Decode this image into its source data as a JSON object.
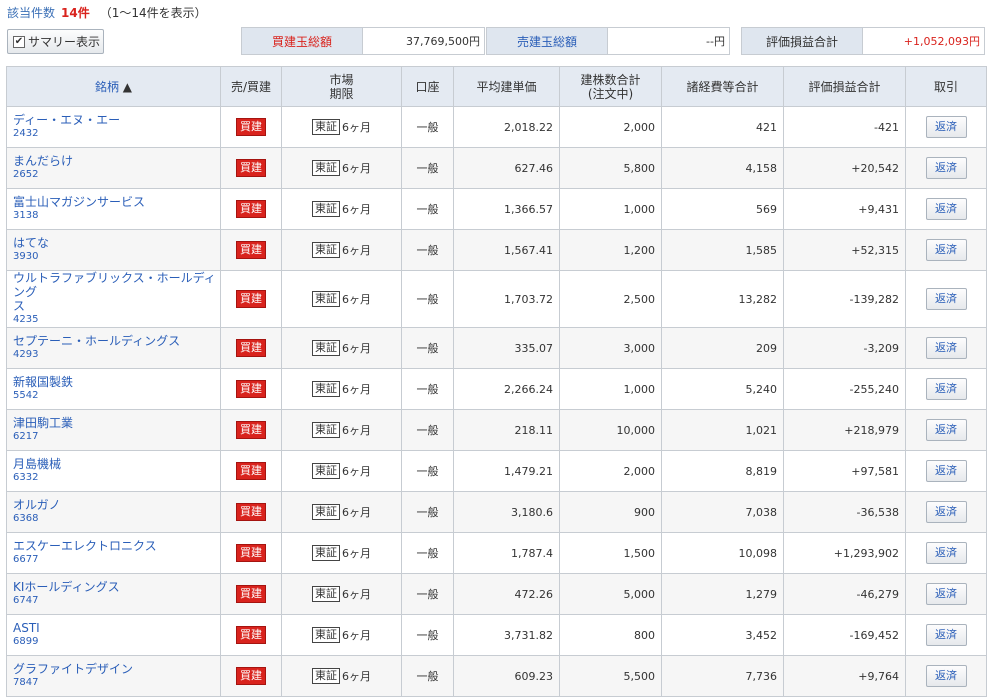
{
  "header": {
    "count_label": "該当件数",
    "count_value": "14件",
    "count_range": "（1〜14件を表示）",
    "summary_toggle": "サマリー表示",
    "summary_checkbox": "✔"
  },
  "summary": {
    "buy_label": "買建玉総額",
    "buy_value": "37,769,500円",
    "sell_label": "売建玉総額",
    "sell_value": "--円",
    "pl_label": "評価損益合計",
    "pl_value": "+1,052,093円"
  },
  "table": {
    "headers": {
      "name": "銘柄",
      "name_sort": "▲",
      "side": "売/買建",
      "market1": "市場",
      "market2": "期限",
      "account": "口座",
      "avg_price": "平均建単価",
      "qty1": "建株数合計",
      "qty2": "(注文中)",
      "fees": "諸経費等合計",
      "pl": "評価損益合計",
      "trade": "取引"
    },
    "rows": [
      {
        "name": "ディー・エヌ・エー",
        "code": "2432",
        "side": "買建",
        "market": "東証",
        "term": "6ヶ月",
        "account": "一般",
        "avg": "2,018.22",
        "qty": "2,000",
        "fees": "421",
        "pl": "-421",
        "pl_sign": "neg",
        "action": "返済"
      },
      {
        "name": "まんだらけ",
        "code": "2652",
        "side": "買建",
        "market": "東証",
        "term": "6ヶ月",
        "account": "一般",
        "avg": "627.46",
        "qty": "5,800",
        "fees": "4,158",
        "pl": "+20,542",
        "pl_sign": "pos",
        "action": "返済"
      },
      {
        "name": "富士山マガジンサービス",
        "code": "3138",
        "side": "買建",
        "market": "東証",
        "term": "6ヶ月",
        "account": "一般",
        "avg": "1,366.57",
        "qty": "1,000",
        "fees": "569",
        "pl": "+9,431",
        "pl_sign": "pos",
        "action": "返済"
      },
      {
        "name": "はてな",
        "code": "3930",
        "side": "買建",
        "market": "東証",
        "term": "6ヶ月",
        "account": "一般",
        "avg": "1,567.41",
        "qty": "1,200",
        "fees": "1,585",
        "pl": "+52,315",
        "pl_sign": "pos",
        "action": "返済"
      },
      {
        "name": "ウルトラファブリックス・ホールディング",
        "name2": "ス",
        "code": "4235",
        "side": "買建",
        "market": "東証",
        "term": "6ヶ月",
        "account": "一般",
        "avg": "1,703.72",
        "qty": "2,500",
        "fees": "13,282",
        "pl": "-139,282",
        "pl_sign": "neg",
        "action": "返済"
      },
      {
        "name": "セプテーニ・ホールディングス",
        "code": "4293",
        "side": "買建",
        "market": "東証",
        "term": "6ヶ月",
        "account": "一般",
        "avg": "335.07",
        "qty": "3,000",
        "fees": "209",
        "pl": "-3,209",
        "pl_sign": "neg",
        "action": "返済"
      },
      {
        "name": "新報国製鉄",
        "code": "5542",
        "side": "買建",
        "market": "東証",
        "term": "6ヶ月",
        "account": "一般",
        "avg": "2,266.24",
        "qty": "1,000",
        "fees": "5,240",
        "pl": "-255,240",
        "pl_sign": "neg",
        "action": "返済"
      },
      {
        "name": "津田駒工業",
        "code": "6217",
        "side": "買建",
        "market": "東証",
        "term": "6ヶ月",
        "account": "一般",
        "avg": "218.11",
        "qty": "10,000",
        "fees": "1,021",
        "pl": "+218,979",
        "pl_sign": "pos",
        "action": "返済"
      },
      {
        "name": "月島機械",
        "code": "6332",
        "side": "買建",
        "market": "東証",
        "term": "6ヶ月",
        "account": "一般",
        "avg": "1,479.21",
        "qty": "2,000",
        "fees": "8,819",
        "pl": "+97,581",
        "pl_sign": "pos",
        "action": "返済"
      },
      {
        "name": "オルガノ",
        "code": "6368",
        "side": "買建",
        "market": "東証",
        "term": "6ヶ月",
        "account": "一般",
        "avg": "3,180.6",
        "qty": "900",
        "fees": "7,038",
        "pl": "-36,538",
        "pl_sign": "neg",
        "action": "返済"
      },
      {
        "name": "エスケーエレクトロニクス",
        "code": "6677",
        "side": "買建",
        "market": "東証",
        "term": "6ヶ月",
        "account": "一般",
        "avg": "1,787.4",
        "qty": "1,500",
        "fees": "10,098",
        "pl": "+1,293,902",
        "pl_sign": "pos",
        "action": "返済"
      },
      {
        "name": "KIホールディングス",
        "code": "6747",
        "side": "買建",
        "market": "東証",
        "term": "6ヶ月",
        "account": "一般",
        "avg": "472.26",
        "qty": "5,000",
        "fees": "1,279",
        "pl": "-46,279",
        "pl_sign": "neg",
        "action": "返済"
      },
      {
        "name": "ASTI",
        "code": "6899",
        "side": "買建",
        "market": "東証",
        "term": "6ヶ月",
        "account": "一般",
        "avg": "3,731.82",
        "qty": "800",
        "fees": "3,452",
        "pl": "-169,452",
        "pl_sign": "neg",
        "action": "返済"
      },
      {
        "name": "グラファイトデザイン",
        "code": "7847",
        "side": "買建",
        "market": "東証",
        "term": "6ヶ月",
        "account": "一般",
        "avg": "609.23",
        "qty": "5,500",
        "fees": "7,736",
        "pl": "+9,764",
        "pl_sign": "pos",
        "action": "返済"
      }
    ]
  },
  "colors": {
    "positive": "#d9231d",
    "negative": "#2a5eb8",
    "header_bg": "#e4eaf2"
  }
}
